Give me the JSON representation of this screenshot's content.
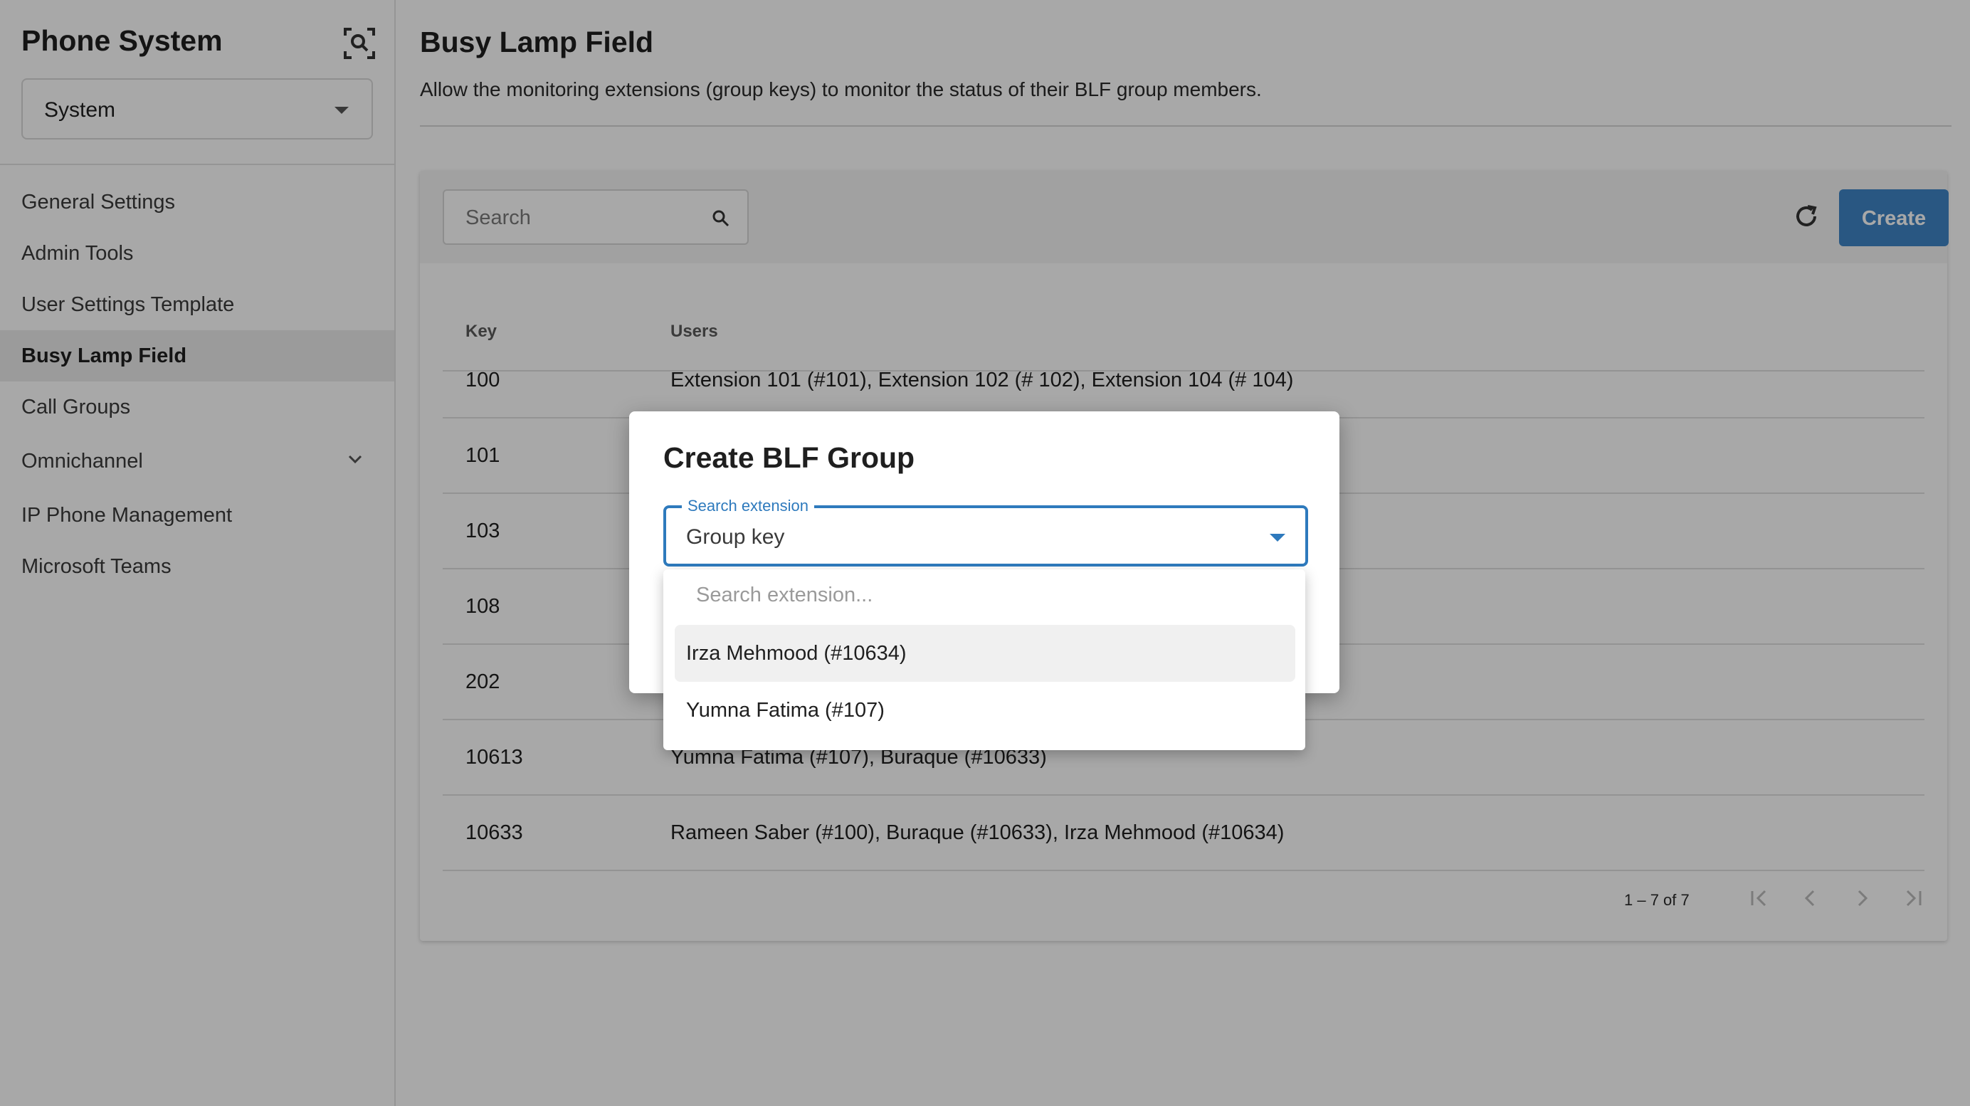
{
  "sidebar": {
    "title": "Phone System",
    "scope_select": {
      "value": "System"
    },
    "items": [
      {
        "label": "General Settings"
      },
      {
        "label": "Admin Tools"
      },
      {
        "label": "User Settings Template"
      },
      {
        "label": "Busy Lamp Field",
        "active": true
      },
      {
        "label": "Call Groups"
      },
      {
        "label": "Omnichannel",
        "expandable": true
      },
      {
        "label": "IP Phone Management"
      },
      {
        "label": "Microsoft Teams"
      }
    ]
  },
  "main": {
    "title": "Busy Lamp Field",
    "description": "Allow the monitoring extensions (group keys) to monitor the status of their BLF group members.",
    "toolbar": {
      "search_placeholder": "Search",
      "create_label": "Create"
    },
    "table": {
      "headers": {
        "key": "Key",
        "users": "Users"
      },
      "rows": [
        {
          "key": "100",
          "users": "Extension 101 (#101), Extension 102 (# 102), Extension 104 (# 104)"
        },
        {
          "key": "101",
          "users": ""
        },
        {
          "key": "103",
          "users": ""
        },
        {
          "key": "108",
          "users": ""
        },
        {
          "key": "202",
          "users": ""
        },
        {
          "key": "10613",
          "users": "Yumna Fatima (#107), Buraque (#10633)"
        },
        {
          "key": "10633",
          "users": "Rameen Saber (#100), Buraque (#10633), Irza Mehmood (#10634)"
        }
      ]
    },
    "pagination": {
      "range_text": "1 – 7 of 7"
    }
  },
  "dialog": {
    "title": "Create BLF Group",
    "field": {
      "label": "Search extension",
      "value": "Group key"
    },
    "dropdown": {
      "search_placeholder": "Search extension...",
      "options": [
        {
          "label": "Irza Mehmood (#10634)",
          "highlighted": true
        },
        {
          "label": "Yumna Fatima (#107)"
        }
      ]
    }
  },
  "colors": {
    "primary": "#3f85c6",
    "focus": "#2e7abd",
    "overlay": "rgba(0,0,0,0.34)"
  },
  "icons": [
    "scan-search-icon",
    "chevron-down-icon",
    "search-icon",
    "refresh-icon",
    "first-page-icon",
    "prev-page-icon",
    "next-page-icon",
    "last-page-icon"
  ]
}
